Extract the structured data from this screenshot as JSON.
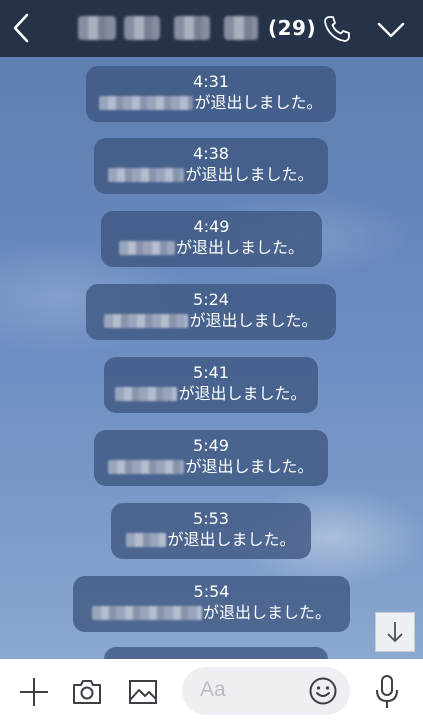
{
  "header": {
    "member_count": "(29)",
    "icons": [
      "chevron-left-icon",
      "phone-icon",
      "chevron-down-icon"
    ]
  },
  "messages": [
    {
      "time": "4:31",
      "text": "が退出しました。"
    },
    {
      "time": "4:38",
      "text": "が退出しました。"
    },
    {
      "time": "4:49",
      "text": "が退出しました。"
    },
    {
      "time": "5:24",
      "text": "が退出しました。"
    },
    {
      "time": "5:41",
      "text": "が退出しました。"
    },
    {
      "time": "5:49",
      "text": "が退出しました。"
    },
    {
      "time": "5:53",
      "text": "が退出しました。"
    },
    {
      "time": "5:54",
      "text": "が退出しました。"
    }
  ],
  "footer": {
    "input_placeholder": "Aa",
    "icons": [
      "plus-icon",
      "camera-icon",
      "image-icon",
      "emoji-icon",
      "microphone-icon"
    ]
  },
  "scroll_down_icon": "arrow-down-icon",
  "colors": {
    "header_bg": "#263248",
    "bubble_bg": "#3e5680",
    "chat_bg": "#6a8ac0"
  }
}
